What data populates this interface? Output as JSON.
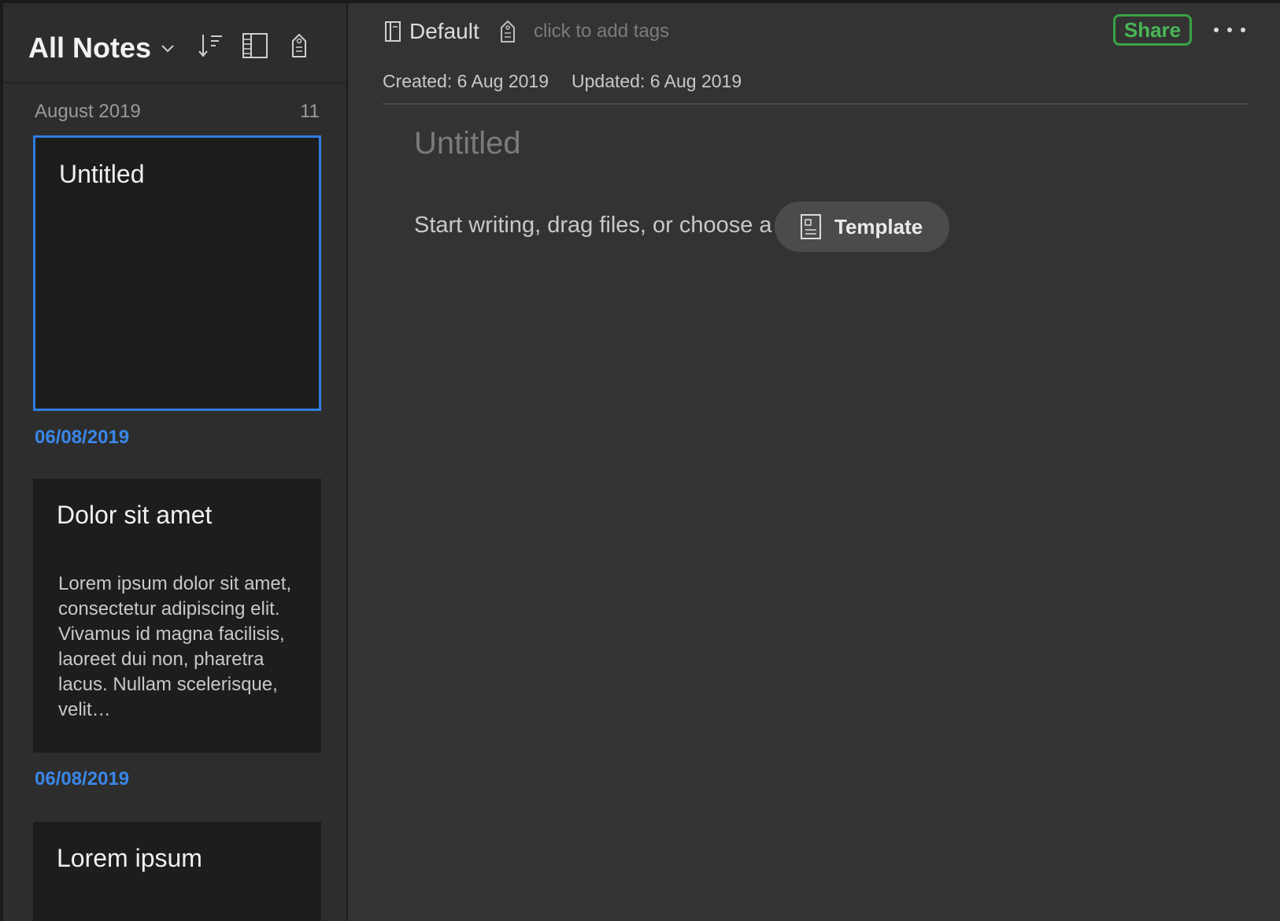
{
  "sidebar": {
    "title": "All Notes",
    "section": {
      "label": "August 2019",
      "count": "11"
    },
    "notes": [
      {
        "title": "Untitled",
        "snippet": "",
        "date": "06/08/2019"
      },
      {
        "title": "Dolor sit amet",
        "snippet": "Lorem ipsum dolor sit amet, consectetur adipiscing elit. Vivamus id magna facilisis, laoreet dui non, pharetra lacus. Nullam scelerisque, velit…",
        "date": "06/08/2019"
      },
      {
        "title": "Lorem ipsum",
        "snippet": "",
        "date": ""
      }
    ]
  },
  "editor": {
    "notebook": "Default",
    "tags_placeholder": "click to add tags",
    "share_label": "Share",
    "created": "Created: 6 Aug 2019",
    "updated": "Updated: 6 Aug 2019",
    "title_placeholder": "Untitled",
    "prompt": "Start writing, drag files, or choose a",
    "template_label": "Template"
  },
  "colors": {
    "accent_blue": "#2f7de1",
    "share_green": "#3aa346",
    "background": "#333333",
    "card": "#1d1d1d"
  },
  "icons": [
    "chevron-down-icon",
    "sort-icon",
    "view-toggle-icon",
    "tag-icon",
    "notebook-icon",
    "template-icon",
    "more-icon"
  ]
}
